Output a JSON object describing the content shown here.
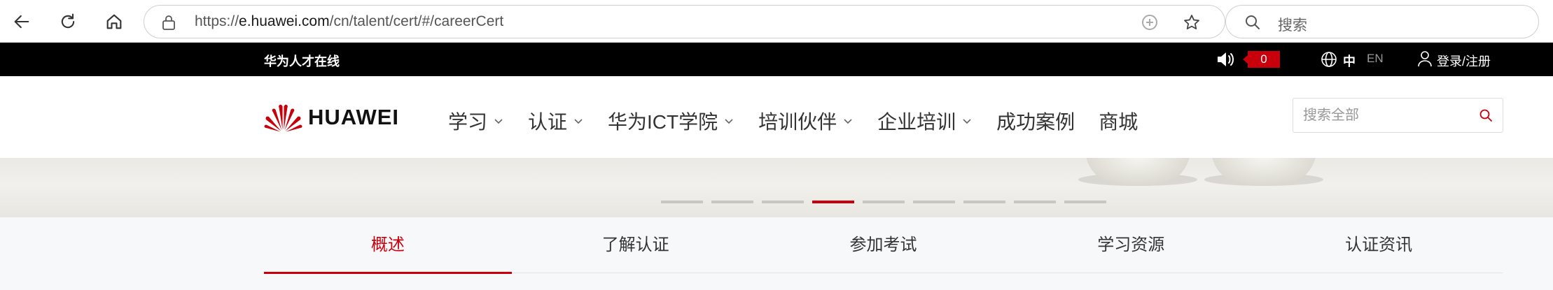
{
  "browser": {
    "url_prefix": "https://",
    "url_host": "e.huawei.com",
    "url_path": "/cn/talent/cert/#/careerCert",
    "search_placeholder": "搜索"
  },
  "topbar": {
    "site_name": "华为人才在线",
    "notification_count": "0",
    "lang_zh": "中",
    "lang_en": "EN",
    "login": "登录/注册"
  },
  "header": {
    "logo_text": "HUAWEI",
    "nav": [
      {
        "label": "学习",
        "has_dropdown": true
      },
      {
        "label": "认证",
        "has_dropdown": true
      },
      {
        "label": "华为ICT学院",
        "has_dropdown": true
      },
      {
        "label": "培训伙伴",
        "has_dropdown": true
      },
      {
        "label": "企业培训",
        "has_dropdown": true
      },
      {
        "label": "成功案例",
        "has_dropdown": false
      },
      {
        "label": "商城",
        "has_dropdown": false
      }
    ],
    "search_placeholder": "搜索全部"
  },
  "banner": {
    "slide_count": 9,
    "active_slide": 4
  },
  "tabs": {
    "items": [
      "概述",
      "了解认证",
      "参加考试",
      "学习资源",
      "认证资讯"
    ],
    "active": 0
  },
  "colors": {
    "brand_red": "#c7000b",
    "topbar_bg": "#000000",
    "tabs_bg": "#f7f8fa"
  }
}
